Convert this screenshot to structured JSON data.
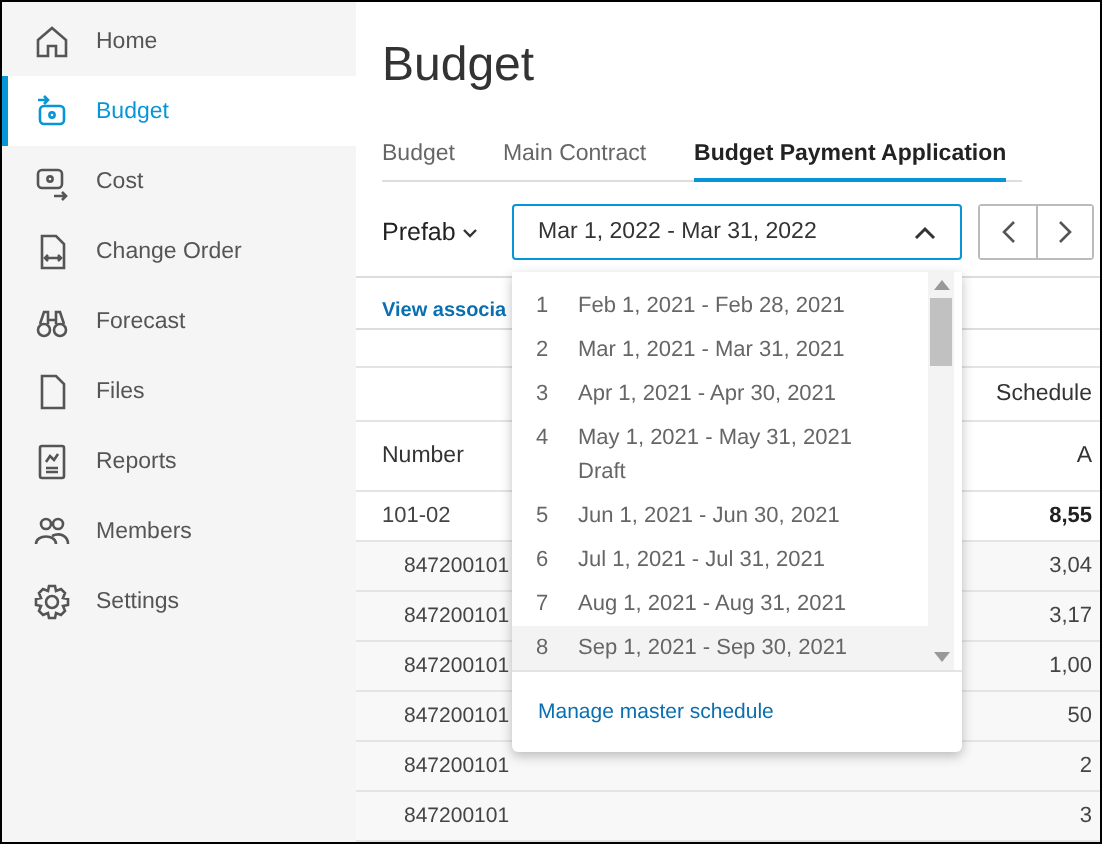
{
  "sidebar": {
    "items": [
      {
        "label": "Home",
        "selected": false
      },
      {
        "label": "Budget",
        "selected": true
      },
      {
        "label": "Cost",
        "selected": false
      },
      {
        "label": "Change Order",
        "selected": false
      },
      {
        "label": "Forecast",
        "selected": false
      },
      {
        "label": "Files",
        "selected": false
      },
      {
        "label": "Reports",
        "selected": false
      },
      {
        "label": "Members",
        "selected": false
      },
      {
        "label": "Settings",
        "selected": false
      }
    ]
  },
  "page_title": "Budget",
  "tabs": [
    {
      "label": "Budget",
      "selected": false
    },
    {
      "label": "Main Contract",
      "selected": false
    },
    {
      "label": "Budget Payment Application",
      "selected": true
    }
  ],
  "toolbar": {
    "filter": "Prefab",
    "period_select": {
      "value": "Mar 1, 2022 - Mar 31, 2022",
      "expanded": true
    }
  },
  "link": "View associa",
  "table": {
    "group_header": "Schedule",
    "columns": [
      "Number",
      "A"
    ],
    "rows": [
      {
        "number": "101-02",
        "amount": "8,55",
        "children": [
          {
            "number": "847200101",
            "amount": "3,04"
          },
          {
            "number": "847200101",
            "amount": "3,17"
          },
          {
            "number": "847200101",
            "amount": "1,00"
          },
          {
            "number": "847200101",
            "amount": "50"
          },
          {
            "number": "847200101",
            "amount": "2"
          },
          {
            "number": "847200101",
            "amount": "3"
          }
        ]
      }
    ]
  },
  "dropdown": {
    "items": [
      {
        "index": "1",
        "label": "Feb 1, 2021 - Feb 28, 2021",
        "highlighted": false
      },
      {
        "index": "2",
        "label": "Mar 1, 2021 - Mar 31, 2021",
        "highlighted": false
      },
      {
        "index": "3",
        "label": "Apr 1, 2021 - Apr 30, 2021",
        "highlighted": false
      },
      {
        "index": "4",
        "label": "May 1, 2021 - May 31, 2021",
        "status": "Draft",
        "highlighted": false
      },
      {
        "index": "5",
        "label": "Jun 1, 2021 - Jun 30, 2021",
        "highlighted": false
      },
      {
        "index": "6",
        "label": "Jul 1, 2021 - Jul 31, 2021",
        "highlighted": false
      },
      {
        "index": "7",
        "label": "Aug 1, 2021 - Aug 31, 2021",
        "highlighted": false
      },
      {
        "index": "8",
        "label": "Sep 1, 2021 - Sep 30, 2021",
        "highlighted": true
      }
    ],
    "footer_link": "Manage master schedule"
  }
}
